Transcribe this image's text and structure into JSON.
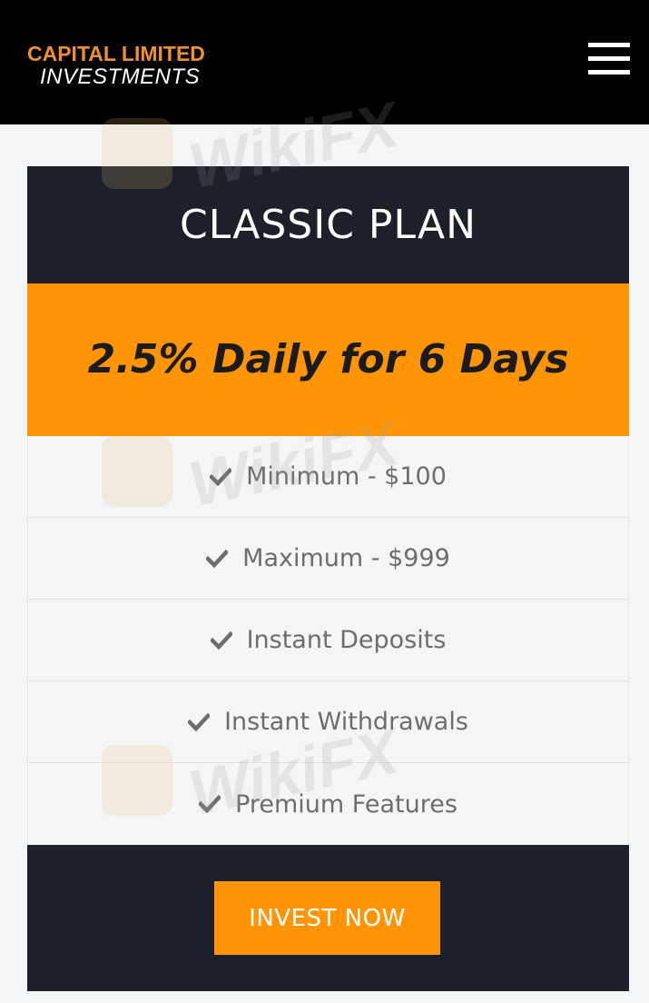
{
  "header": {
    "logo_line1": "CAPITAL LIMITED",
    "logo_line2": "INVESTMENTS",
    "menu_icon": "hamburger-menu-icon"
  },
  "plan": {
    "title": "CLASSIC PLAN",
    "rate": "2.5% Daily for 6 Days",
    "features": [
      {
        "label": "Minimum - $100",
        "icon": "check-icon"
      },
      {
        "label": "Maximum - $999",
        "icon": "check-icon"
      },
      {
        "label": "Instant Deposits",
        "icon": "check-icon"
      },
      {
        "label": "Instant Withdrawals",
        "icon": "check-icon"
      },
      {
        "label": "Premium Features",
        "icon": "check-icon"
      }
    ],
    "cta_label": "INVEST NOW"
  },
  "watermark": {
    "text": "WikiFX"
  },
  "colors": {
    "header_bg": "#000000",
    "brand_orange": "#ff9504",
    "logo_orange": "#f0902a",
    "card_dark": "#1b202b",
    "feature_text": "#6d6d6d",
    "page_bg": "#f3f5f6"
  }
}
